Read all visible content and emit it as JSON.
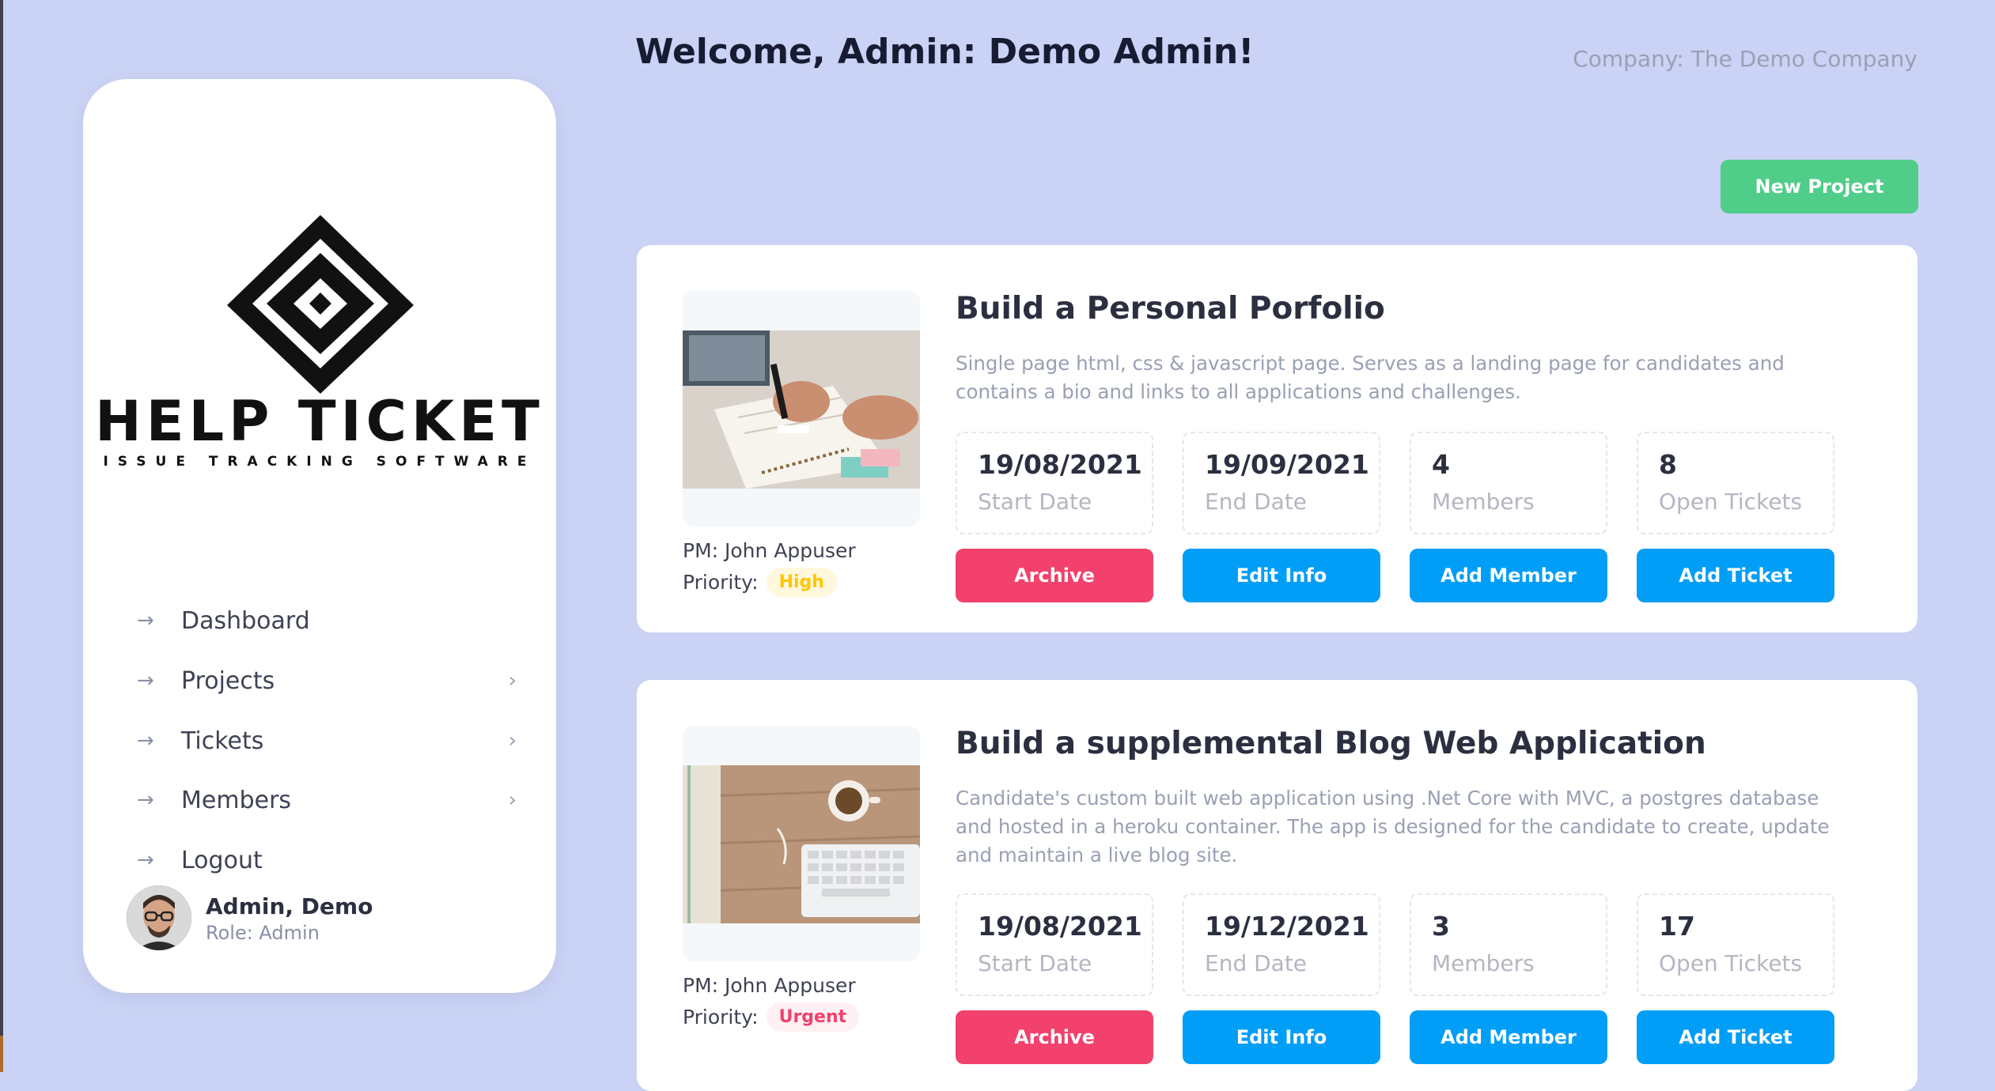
{
  "header": {
    "welcome": "Welcome, Admin: Demo Admin!",
    "company": "Company: The Demo Company",
    "new_project_label": "New Project"
  },
  "sidebar": {
    "logo_text": "HELP TICKET",
    "logo_sub": "ISSUE TRACKING SOFTWARE",
    "items": [
      {
        "label": "Dashboard",
        "has_submenu": false
      },
      {
        "label": "Projects",
        "has_submenu": true
      },
      {
        "label": "Tickets",
        "has_submenu": true
      },
      {
        "label": "Members",
        "has_submenu": true
      },
      {
        "label": "Logout",
        "has_submenu": false
      }
    ],
    "user": {
      "name": "Admin, Demo",
      "role": "Role: Admin"
    }
  },
  "projects": [
    {
      "title": "Build a Personal Porfolio",
      "description": "Single page html, css & javascript page. Serves as a landing page for candidates and contains a bio and links to all applications and challenges.",
      "pm": "PM: John Appuser",
      "priority_label": "Priority:",
      "priority": "High",
      "stats": [
        {
          "value": "19/08/2021",
          "label": "Start Date"
        },
        {
          "value": "19/09/2021",
          "label": "End Date"
        },
        {
          "value": "4",
          "label": "Members"
        },
        {
          "value": "8",
          "label": "Open Tickets"
        }
      ],
      "buttons": {
        "archive": "Archive",
        "edit": "Edit Info",
        "add_member": "Add Member",
        "add_ticket": "Add Ticket"
      }
    },
    {
      "title": "Build a supplemental Blog Web Application",
      "description": "Candidate's custom built web application using .Net Core with MVC, a postgres database and hosted in a heroku container. The app is designed for the candidate to create, update and maintain a live blog site.",
      "pm": "PM: John Appuser",
      "priority_label": "Priority:",
      "priority": "Urgent",
      "stats": [
        {
          "value": "19/08/2021",
          "label": "Start Date"
        },
        {
          "value": "19/12/2021",
          "label": "End Date"
        },
        {
          "value": "3",
          "label": "Members"
        },
        {
          "value": "17",
          "label": "Open Tickets"
        }
      ],
      "buttons": {
        "archive": "Archive",
        "edit": "Edit Info",
        "add_member": "Add Member",
        "add_ticket": "Add Ticket"
      }
    }
  ],
  "colors": {
    "background": "#cad3f5",
    "success": "#50cd89",
    "primary": "#009ef7",
    "danger": "#f1416c",
    "warning": "#ffc700"
  }
}
